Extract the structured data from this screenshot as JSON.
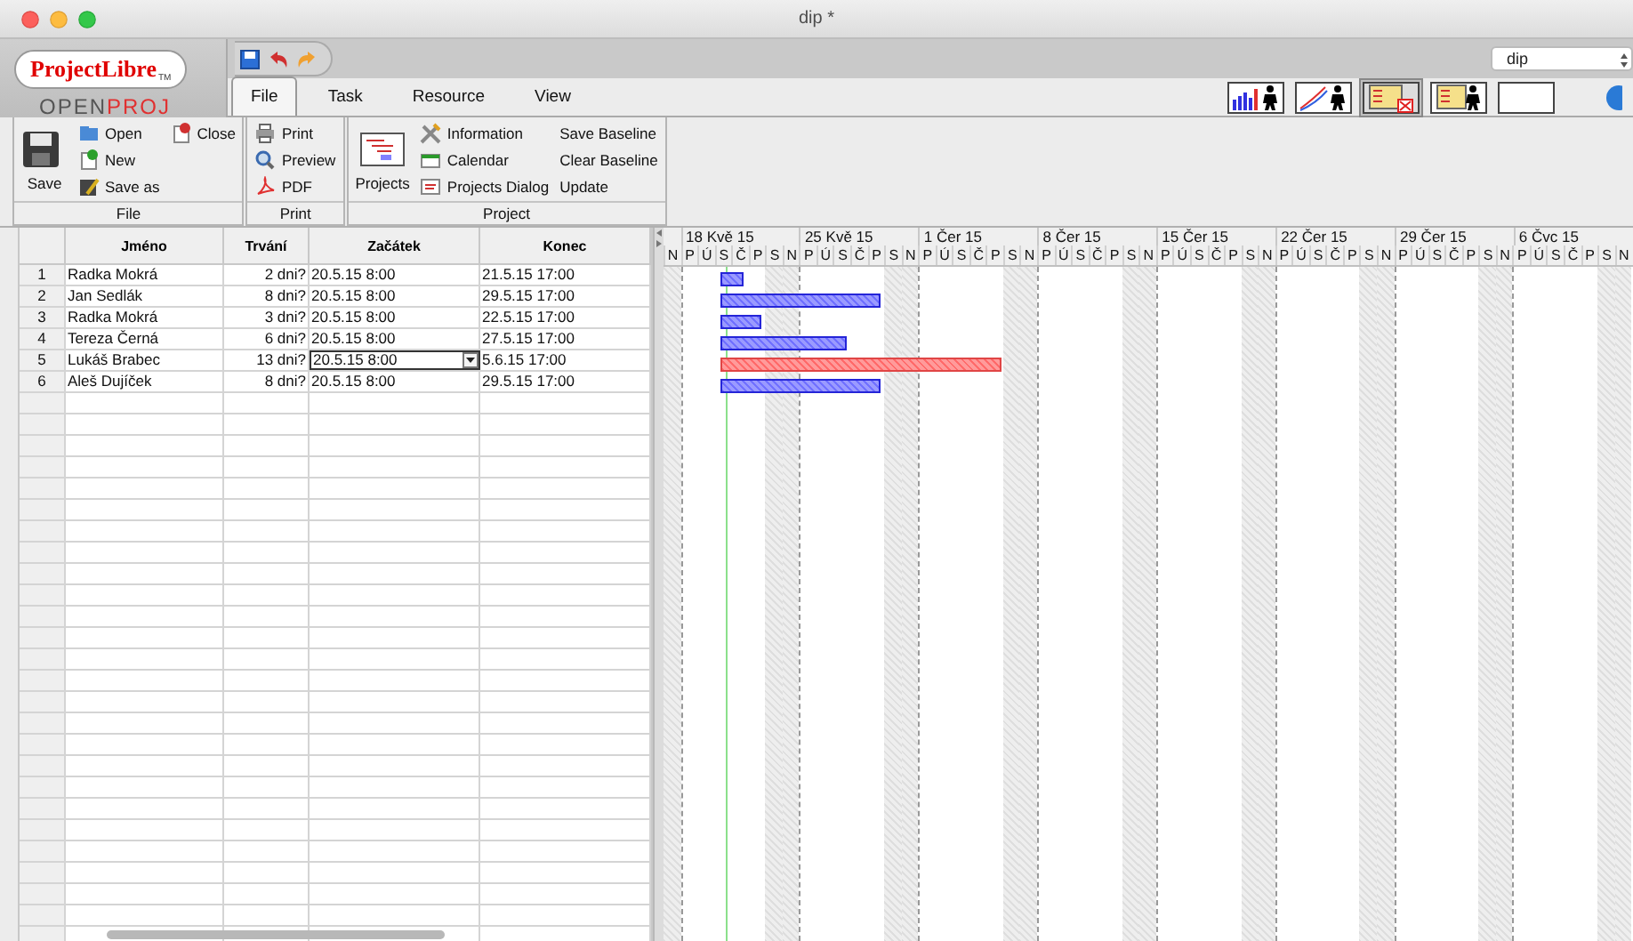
{
  "window": {
    "title": "dip *"
  },
  "logo": {
    "name": "ProjectLibre",
    "mark": "TM",
    "subtitle": "OPEN**PROJ**"
  },
  "project_selector": {
    "value": "dip"
  },
  "tabs": [
    {
      "label": "File",
      "selected": true
    },
    {
      "label": "Task",
      "selected": false
    },
    {
      "label": "Resource",
      "selected": false
    },
    {
      "label": "View",
      "selected": false
    }
  ],
  "view_buttons": [
    {
      "kind": "histogram",
      "selected": false
    },
    {
      "kind": "curve",
      "selected": false
    },
    {
      "kind": "table-x",
      "selected": true
    },
    {
      "kind": "table",
      "selected": false
    },
    {
      "kind": "blank",
      "selected": false
    }
  ],
  "ribbon": {
    "groups": [
      {
        "title": "File",
        "columns": [
          {
            "kind": "large",
            "items": [
              {
                "label": "Save"
              }
            ]
          },
          {
            "kind": "small",
            "items": [
              {
                "label": "Open"
              },
              {
                "label": "New"
              },
              {
                "label": "Save as"
              }
            ]
          },
          {
            "kind": "small",
            "items": [
              {
                "label": "Close"
              }
            ]
          }
        ]
      },
      {
        "title": "Print",
        "columns": [
          {
            "kind": "small",
            "items": [
              {
                "label": "Print"
              },
              {
                "label": "Preview"
              },
              {
                "label": "PDF"
              }
            ]
          }
        ]
      },
      {
        "title": "Project",
        "columns": [
          {
            "kind": "large",
            "items": [
              {
                "label": "Projects"
              }
            ]
          },
          {
            "kind": "small",
            "items": [
              {
                "label": "Information"
              },
              {
                "label": "Calendar"
              },
              {
                "label": "Projects Dialog"
              }
            ]
          },
          {
            "kind": "text",
            "items": [
              {
                "label": "Save Baseline"
              },
              {
                "label": "Clear Baseline"
              },
              {
                "label": "Update"
              }
            ]
          }
        ]
      }
    ]
  },
  "table": {
    "columns": [
      "Jméno",
      "Trvání",
      "Začátek",
      "Konec"
    ]
  },
  "tasks": [
    {
      "number": "1",
      "name": "Radka Mokrá",
      "duration": "2 dni?",
      "start": "20.5.15 8:00",
      "end": "21.5.15 17:00",
      "editing": false,
      "critical": false
    },
    {
      "number": "2",
      "name": "Jan Sedlák",
      "duration": "8 dni?",
      "start": "20.5.15 8:00",
      "end": "29.5.15 17:00",
      "editing": false,
      "critical": false
    },
    {
      "number": "3",
      "name": "Radka Mokrá",
      "duration": "3 dni?",
      "start": "20.5.15 8:00",
      "end": "22.5.15 17:00",
      "editing": false,
      "critical": false
    },
    {
      "number": "4",
      "name": "Tereza Černá",
      "duration": "6 dni?",
      "start": "20.5.15 8:00",
      "end": "27.5.15 17:00",
      "editing": false,
      "critical": false
    },
    {
      "number": "5",
      "name": "Lukáš Brabec",
      "duration": "13 dni?",
      "start": "20.5.15 8:00",
      "end": "5.6.15 17:00",
      "editing": true,
      "critical": true
    },
    {
      "number": "6",
      "name": "Aleš Dujíček",
      "duration": "8 dni?",
      "start": "20.5.15 8:00",
      "end": "29.5.15 17:00",
      "editing": false,
      "critical": false
    }
  ],
  "gantt": {
    "lead_days": [
      {
        "label": "N",
        "weekend": true
      }
    ],
    "weeks": [
      {
        "label": "18 Kvě 15",
        "days": [
          {
            "label": "P",
            "weekend": false
          },
          {
            "label": "Ú",
            "weekend": false
          },
          {
            "label": "S",
            "weekend": false
          },
          {
            "label": "Č",
            "weekend": false
          },
          {
            "label": "P",
            "weekend": false
          },
          {
            "label": "S",
            "weekend": true
          },
          {
            "label": "N",
            "weekend": true
          }
        ]
      },
      {
        "label": "25 Kvě 15",
        "days": [
          {
            "label": "P",
            "weekend": false
          },
          {
            "label": "Ú",
            "weekend": false
          },
          {
            "label": "S",
            "weekend": false
          },
          {
            "label": "Č",
            "weekend": false
          },
          {
            "label": "P",
            "weekend": false
          },
          {
            "label": "S",
            "weekend": true
          },
          {
            "label": "N",
            "weekend": true
          }
        ]
      },
      {
        "label": "1 Čer 15",
        "days": [
          {
            "label": "P",
            "weekend": false
          },
          {
            "label": "Ú",
            "weekend": false
          },
          {
            "label": "S",
            "weekend": false
          },
          {
            "label": "Č",
            "weekend": false
          },
          {
            "label": "P",
            "weekend": false
          },
          {
            "label": "S",
            "weekend": true
          },
          {
            "label": "N",
            "weekend": true
          }
        ]
      },
      {
        "label": "8 Čer 15",
        "days": [
          {
            "label": "P",
            "weekend": false
          },
          {
            "label": "Ú",
            "weekend": false
          },
          {
            "label": "S",
            "weekend": false
          },
          {
            "label": "Č",
            "weekend": false
          },
          {
            "label": "P",
            "weekend": false
          },
          {
            "label": "S",
            "weekend": true
          },
          {
            "label": "N",
            "weekend": true
          }
        ]
      },
      {
        "label": "15 Čer 15",
        "days": [
          {
            "label": "P",
            "weekend": false
          },
          {
            "label": "Ú",
            "weekend": false
          },
          {
            "label": "S",
            "weekend": false
          },
          {
            "label": "Č",
            "weekend": false
          },
          {
            "label": "P",
            "weekend": false
          },
          {
            "label": "S",
            "weekend": true
          },
          {
            "label": "N",
            "weekend": true
          }
        ]
      },
      {
        "label": "22 Čer 15",
        "days": [
          {
            "label": "P",
            "weekend": false
          },
          {
            "label": "Ú",
            "weekend": false
          },
          {
            "label": "S",
            "weekend": false
          },
          {
            "label": "Č",
            "weekend": false
          },
          {
            "label": "P",
            "weekend": false
          },
          {
            "label": "S",
            "weekend": true
          },
          {
            "label": "N",
            "weekend": true
          }
        ]
      },
      {
        "label": "29 Čer 15",
        "days": [
          {
            "label": "P",
            "weekend": false
          },
          {
            "label": "Ú",
            "weekend": false
          },
          {
            "label": "S",
            "weekend": false
          },
          {
            "label": "Č",
            "weekend": false
          },
          {
            "label": "P",
            "weekend": false
          },
          {
            "label": "S",
            "weekend": true
          },
          {
            "label": "N",
            "weekend": true
          }
        ]
      },
      {
        "label": "6 Čvc 15",
        "days": [
          {
            "label": "P",
            "weekend": false
          },
          {
            "label": "Ú",
            "weekend": false
          },
          {
            "label": "S",
            "weekend": false
          },
          {
            "label": "Č",
            "weekend": false
          },
          {
            "label": "P",
            "weekend": false
          },
          {
            "label": "S",
            "weekend": true
          },
          {
            "label": "N",
            "weekend": true
          }
        ]
      }
    ]
  }
}
